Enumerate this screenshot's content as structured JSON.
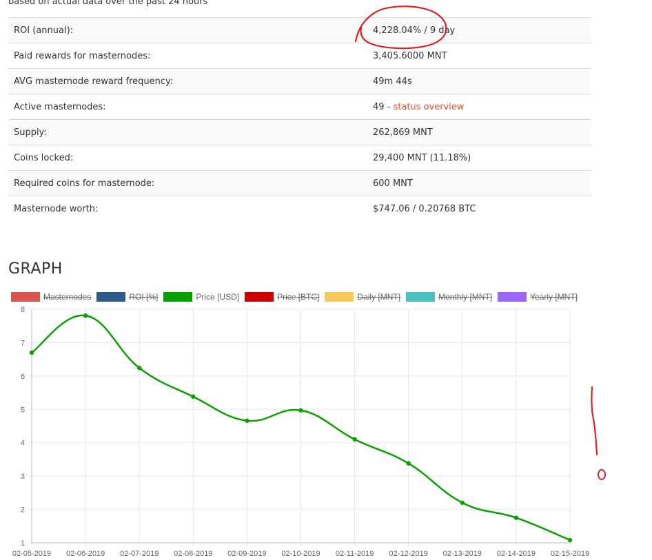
{
  "header": {
    "subtitle": "based on actual data over the past 24 hours"
  },
  "stats": [
    {
      "label": "ROI (annual):",
      "value": "4,228.04% / 9 day"
    },
    {
      "label": "Paid rewards for masternodes:",
      "value": "3,405.6000 MNT"
    },
    {
      "label": "AVG masternode reward frequency:",
      "value": "49m 44s"
    },
    {
      "label": "Active masternodes:",
      "value": "49 - ",
      "link": "status overview"
    },
    {
      "label": "Supply:",
      "value": "262,869 MNT"
    },
    {
      "label": "Coins locked:",
      "value": "29,400 MNT (11.18%)"
    },
    {
      "label": "Required coins for masternode:",
      "value": "600 MNT"
    },
    {
      "label": "Masternode worth:",
      "value": "$747.06 / 0.20768 BTC"
    }
  ],
  "graph": {
    "heading": "GRAPH"
  },
  "colors": {
    "link": "#e0542f",
    "annotation": "#d9232a"
  },
  "chart_data": {
    "type": "line",
    "legend": [
      {
        "name": "Masternodes",
        "color": "#d9534f",
        "hidden": true
      },
      {
        "name": "ROI [%]",
        "color": "#2e5b8a",
        "hidden": true
      },
      {
        "name": "Price [USD]",
        "color": "#0aa000",
        "hidden": false
      },
      {
        "name": "Price [BTC]",
        "color": "#cc0000",
        "hidden": true
      },
      {
        "name": "Daily [MNT]",
        "color": "#f7c95c",
        "hidden": true
      },
      {
        "name": "Monthly [MNT]",
        "color": "#4cbfbf",
        "hidden": true
      },
      {
        "name": "Yearly [MNT]",
        "color": "#9966ff",
        "hidden": true
      }
    ],
    "categories": [
      "02-05-2019",
      "02-06-2019",
      "02-07-2019",
      "02-08-2019",
      "02-09-2019",
      "02-10-2019",
      "02-11-2019",
      "02-12-2019",
      "02-13-2019",
      "02-14-2019",
      "02-15-2019"
    ],
    "series": [
      {
        "name": "Price [USD]",
        "values": [
          6.7,
          7.81,
          6.24,
          5.38,
          4.66,
          4.97,
          4.1,
          3.38,
          2.2,
          1.75,
          1.08
        ]
      }
    ],
    "ylim": [
      1,
      8
    ],
    "yticks": [
      "1",
      "2",
      "3",
      "4",
      "5",
      "6",
      "7",
      "8"
    ],
    "grid": true,
    "legend_placement": "top-left"
  }
}
